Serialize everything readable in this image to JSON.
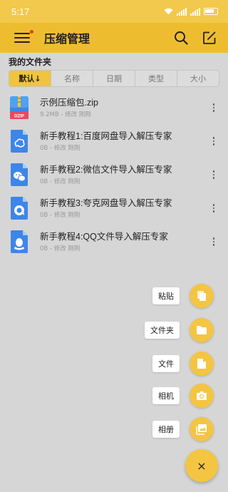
{
  "status_bar": {
    "time": "5:17"
  },
  "app_bar": {
    "title": "压缩管理"
  },
  "section": {
    "title": "我的文件夹"
  },
  "sort_tabs": [
    {
      "label": "默认↓",
      "active": true
    },
    {
      "label": "名称",
      "active": false
    },
    {
      "label": "日期",
      "active": false
    },
    {
      "label": "类型",
      "active": false
    },
    {
      "label": "大小",
      "active": false
    }
  ],
  "files": [
    {
      "name": "示例压缩包.zip",
      "meta": "9.2MB - 修改 刚刚",
      "icon": "zip-file-icon"
    },
    {
      "name": "新手教程1:百度网盘导入解压专家",
      "meta": "0B - 修改 刚刚",
      "icon": "baidu-doc-icon"
    },
    {
      "name": "新手教程2:微信文件导入解压专家",
      "meta": "0B - 修改 刚刚",
      "icon": "wechat-doc-icon"
    },
    {
      "name": "新手教程3:夸克网盘导入解压专家",
      "meta": "0B - 修改 刚刚",
      "icon": "quark-doc-icon"
    },
    {
      "name": "新手教程4:QQ文件导入解压专家",
      "meta": "0B - 修改 刚刚",
      "icon": "qq-doc-icon"
    }
  ],
  "fab_menu": [
    {
      "label": "粘贴",
      "icon": "paste-icon"
    },
    {
      "label": "文件夹",
      "icon": "folder-icon"
    },
    {
      "label": "文件",
      "icon": "file-icon"
    },
    {
      "label": "相机",
      "icon": "camera-icon"
    },
    {
      "label": "相册",
      "icon": "gallery-icon"
    }
  ],
  "fab_close": {
    "symbol": "×"
  },
  "colors": {
    "accent": "#f4c542",
    "app_bar": "#eebd2f",
    "status_bar": "#f2c94c",
    "background": "#d6d6d6",
    "file_icon_blue": "#3d86e8"
  }
}
